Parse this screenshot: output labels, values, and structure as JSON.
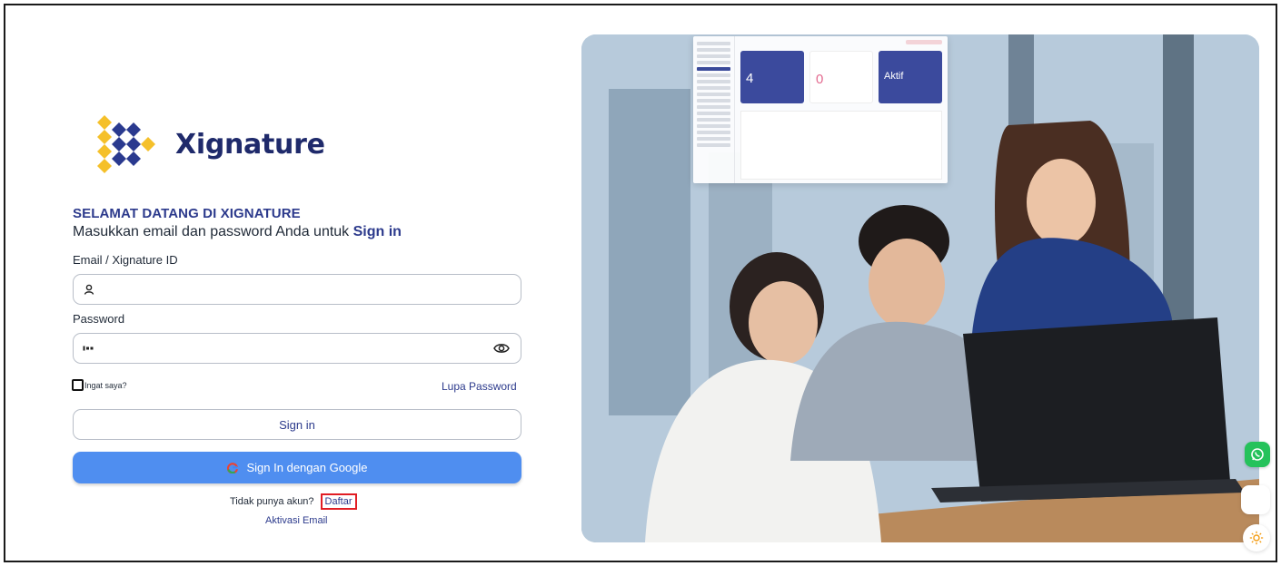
{
  "brand": {
    "name": "Xignature"
  },
  "login": {
    "welcome": "SELAMAT DATANG DI XIGNATURE",
    "subtitle_prefix": "Masukkan email dan password Anda untuk ",
    "subtitle_action": "Sign in",
    "email_label": "Email / Xignature ID",
    "email_value": "",
    "password_label": "Password",
    "password_value": "",
    "remember_label": "Ingat saya?",
    "remember_checked": false,
    "forgot_label": "Lupa Password",
    "signin_label": "Sign in",
    "google_label": "Sign In dengan Google",
    "no_account_text": "Tidak punya akun?",
    "register_label": "Daftar",
    "activate_label": "Aktivasi Email"
  },
  "hero": {
    "dashboard_cards": [
      {
        "value": "4"
      },
      {
        "value": "0"
      },
      {
        "value": "Aktif"
      }
    ]
  },
  "colors": {
    "brand_navy": "#1f2a6b",
    "accent_blue": "#4f8ef0",
    "logo_gold": "#f5c02a",
    "logo_navy": "#2a3a8f",
    "highlight_red": "#e11d24",
    "whatsapp_green": "#25c25b"
  },
  "icons": {
    "user": "user-icon",
    "password": "key-icon",
    "eye": "eye-icon",
    "google": "google-icon",
    "whatsapp": "whatsapp-icon",
    "theme": "sun-icon"
  }
}
